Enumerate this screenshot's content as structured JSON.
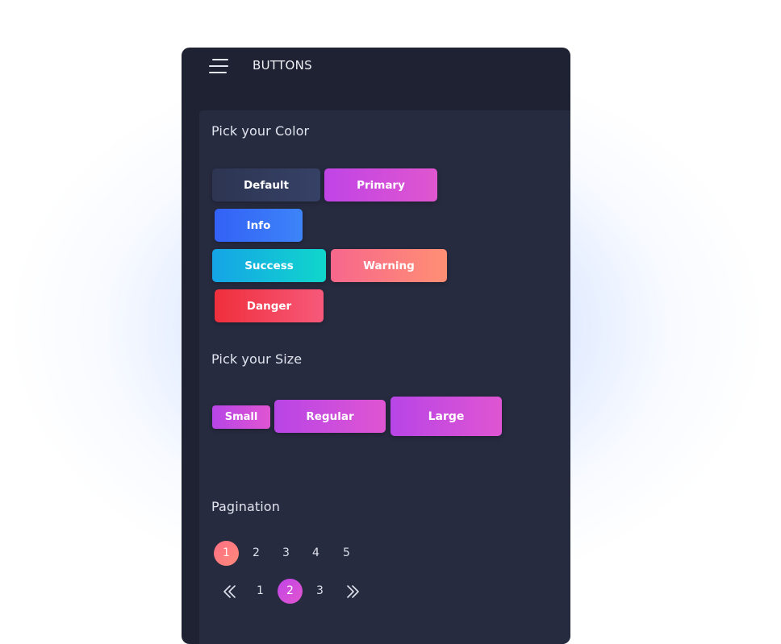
{
  "header": {
    "title": "BUTTONS",
    "menu_icon": "hamburger-menu-icon"
  },
  "colors_section": {
    "title": "Pick your Color",
    "buttons": {
      "default": "Default",
      "primary": "Primary",
      "info": "Info",
      "success": "Success",
      "warning": "Warning",
      "danger": "Danger"
    }
  },
  "size_section": {
    "title": "Pick your Size",
    "buttons": {
      "small": "Small",
      "regular": "Regular",
      "large": "Large"
    }
  },
  "pagination_section": {
    "title": "Pagination",
    "row1": {
      "pages": [
        "1",
        "2",
        "3",
        "4",
        "5"
      ],
      "active": "1"
    },
    "row2": {
      "prev_icon": "double-chevron-left-icon",
      "next_icon": "double-chevron-right-icon",
      "pages": [
        "1",
        "2",
        "3"
      ],
      "active": "2"
    }
  },
  "theme": {
    "panel_bg": "#1f2233",
    "content_bg": "#272b40",
    "primary_accent": "#c044e6",
    "coral_accent": "#ff7a80"
  }
}
